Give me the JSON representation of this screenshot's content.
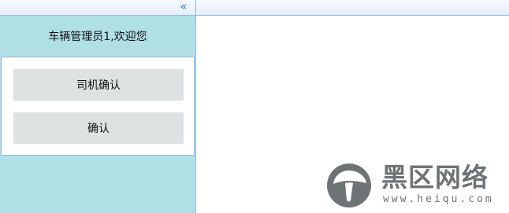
{
  "header": {
    "collapse_glyph": "«",
    "collapse_icon": "double-chevron-left-icon"
  },
  "sidebar": {
    "welcome_text": "车辆管理员1,欢迎您",
    "menu": [
      {
        "label": "司机确认"
      },
      {
        "label": "确认"
      }
    ]
  },
  "watermark": {
    "title": "黑区网络",
    "url": "www.heiqu.com",
    "logo_icon": "mushroom-logo-icon"
  },
  "colors": {
    "sidebar_bg": "#b0dfe5",
    "border": "#95b8e7",
    "button_bg": "#dfe2e2"
  }
}
